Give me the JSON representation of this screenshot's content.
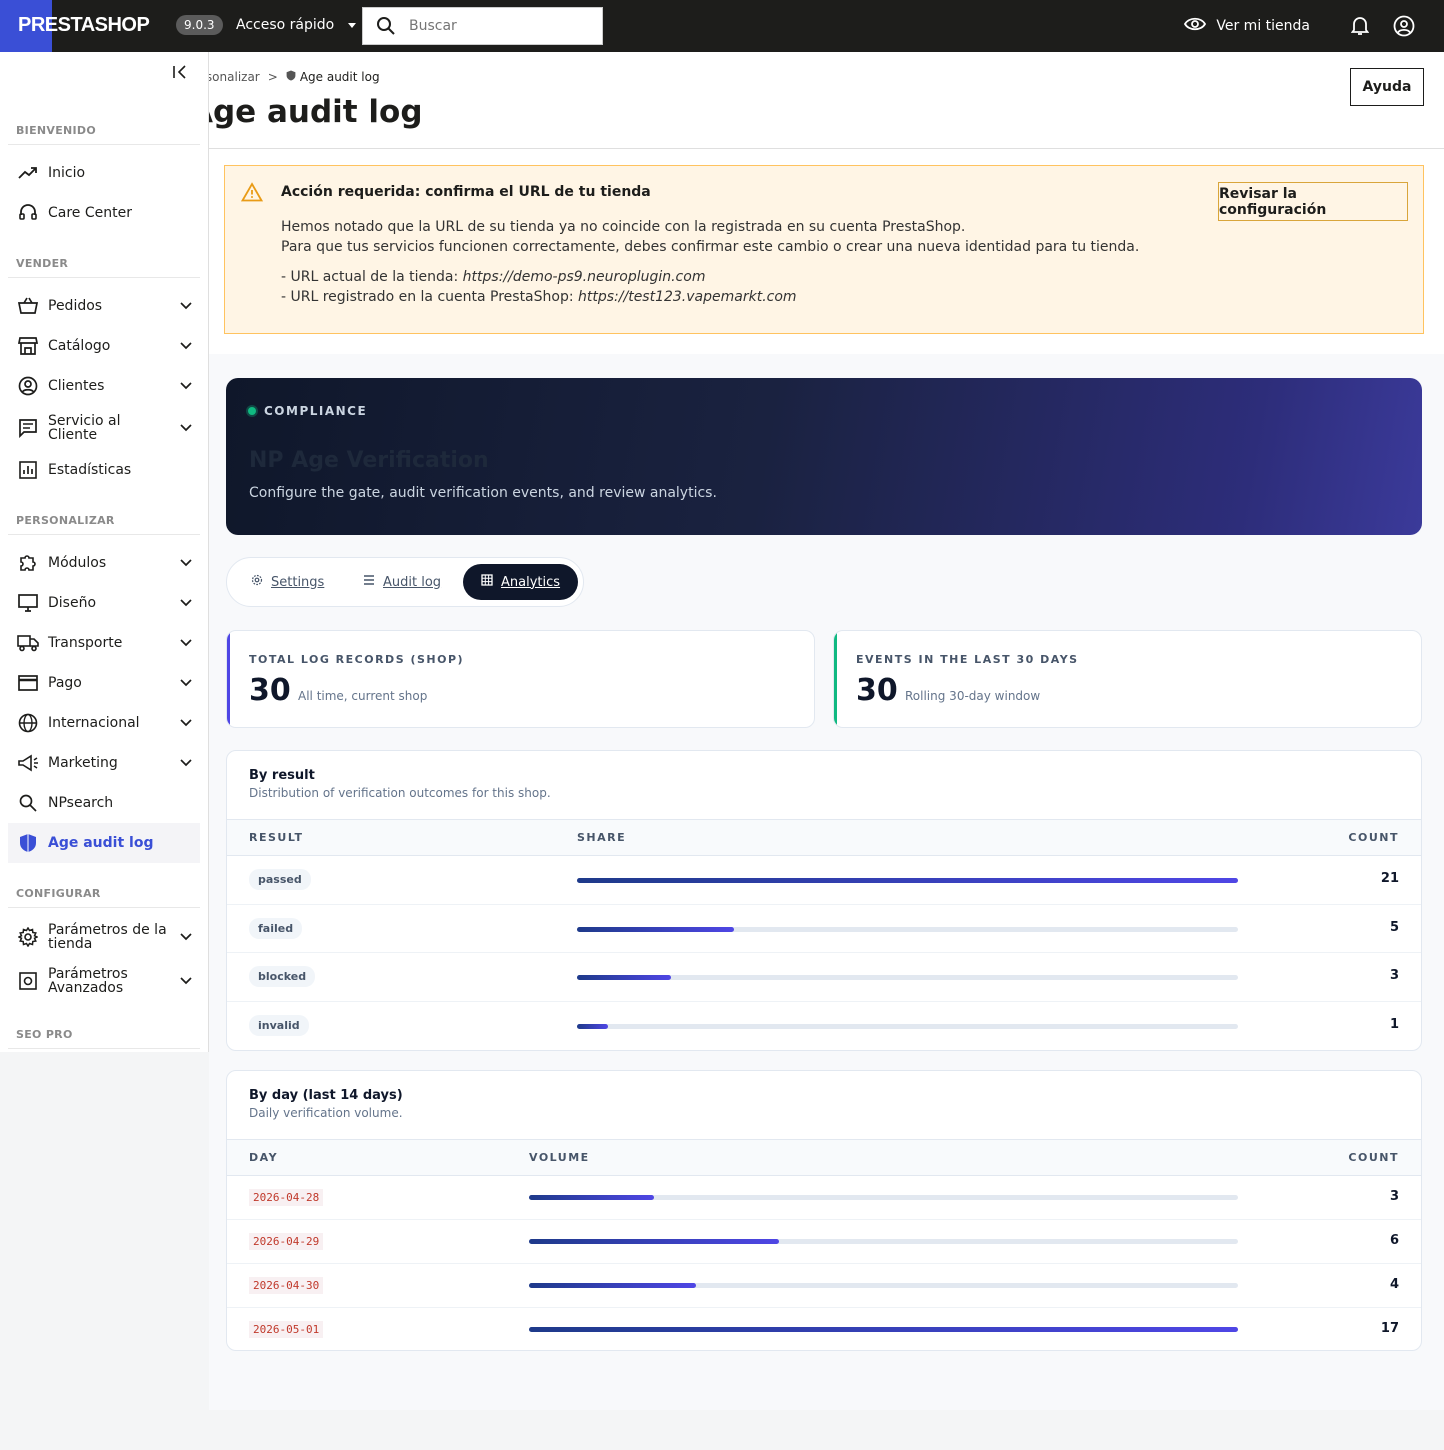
{
  "topbar": {
    "logo": "PRESTASHOP",
    "version": "9.0.3",
    "quick_access": "Acceso rápido",
    "search_placeholder": "Buscar",
    "view_store": "Ver mi tienda"
  },
  "sidebar": {
    "sections": {
      "welcome": "BIENVENIDO",
      "sell": "VENDER",
      "customize": "PERSONALIZAR",
      "configure": "CONFIGURAR",
      "seo": "SEO PRO"
    },
    "items": {
      "home": "Inicio",
      "care": "Care Center",
      "orders": "Pedidos",
      "catalog": "Catálogo",
      "customers": "Clientes",
      "service_1": "Servicio al",
      "service_2": "Cliente",
      "stats": "Estadísticas",
      "modules": "Módulos",
      "design": "Diseño",
      "shipping": "Transporte",
      "payment": "Pago",
      "international": "Internacional",
      "marketing": "Marketing",
      "npsearch": "NPsearch",
      "age_audit": "Age audit log",
      "shop_params_1": "Parámetros de la",
      "shop_params_2": "tienda",
      "adv_params_1": "Parámetros",
      "adv_params_2": "Avanzados"
    }
  },
  "header": {
    "breadcrumb_parent": "rsonalizar",
    "breadcrumb_sep": ">",
    "breadcrumb_current": "Age audit log",
    "title": "Age audit log",
    "help": "Ayuda"
  },
  "alert": {
    "title": "Acción requerida: confirma el URL de tu tienda",
    "line1": "Hemos notado que la URL de su tienda ya no coincide con la registrada en su cuenta PrestaShop.",
    "line2": "Para que tus servicios funcionen correctamente, debes confirmar este cambio o crear una nueva identidad para tu tienda.",
    "line3_label": "- URL actual de la tienda: ",
    "line3_url": "https://demo-ps9.neuroplugin.com",
    "line4_label": "- URL registrado en la cuenta PrestaShop: ",
    "line4_url": "https://test123.vapemarkt.com",
    "button": "Revisar la configuración"
  },
  "hero": {
    "tag": "COMPLIANCE",
    "title": "NP Age Verification",
    "subtitle": "Configure the gate, audit verification events, and review analytics."
  },
  "tabs": {
    "settings": "Settings",
    "audit": "Audit log",
    "analytics": "Analytics"
  },
  "kpis": [
    {
      "label": "TOTAL LOG RECORDS (SHOP)",
      "value": "30",
      "note": "All time, current shop",
      "color": "#4f46e5"
    },
    {
      "label": "EVENTS IN THE LAST 30 DAYS",
      "value": "30",
      "note": "Rolling 30-day window",
      "color": "#10b981"
    }
  ],
  "by_result": {
    "title": "By result",
    "subtitle": "Distribution of verification outcomes for this shop.",
    "col_result": "RESULT",
    "col_share": "SHARE",
    "col_count": "COUNT",
    "max": 21,
    "rows": [
      {
        "label": "passed",
        "count": 21
      },
      {
        "label": "failed",
        "count": 5
      },
      {
        "label": "blocked",
        "count": 3
      },
      {
        "label": "invalid",
        "count": 1
      }
    ]
  },
  "by_day": {
    "title": "By day (last 14 days)",
    "subtitle": "Daily verification volume.",
    "col_day": "DAY",
    "col_volume": "VOLUME",
    "col_count": "COUNT",
    "max": 17,
    "rows": [
      {
        "day": "2026-04-28",
        "count": 3
      },
      {
        "day": "2026-04-29",
        "count": 6
      },
      {
        "day": "2026-04-30",
        "count": 4
      },
      {
        "day": "2026-05-01",
        "count": 17
      }
    ]
  }
}
